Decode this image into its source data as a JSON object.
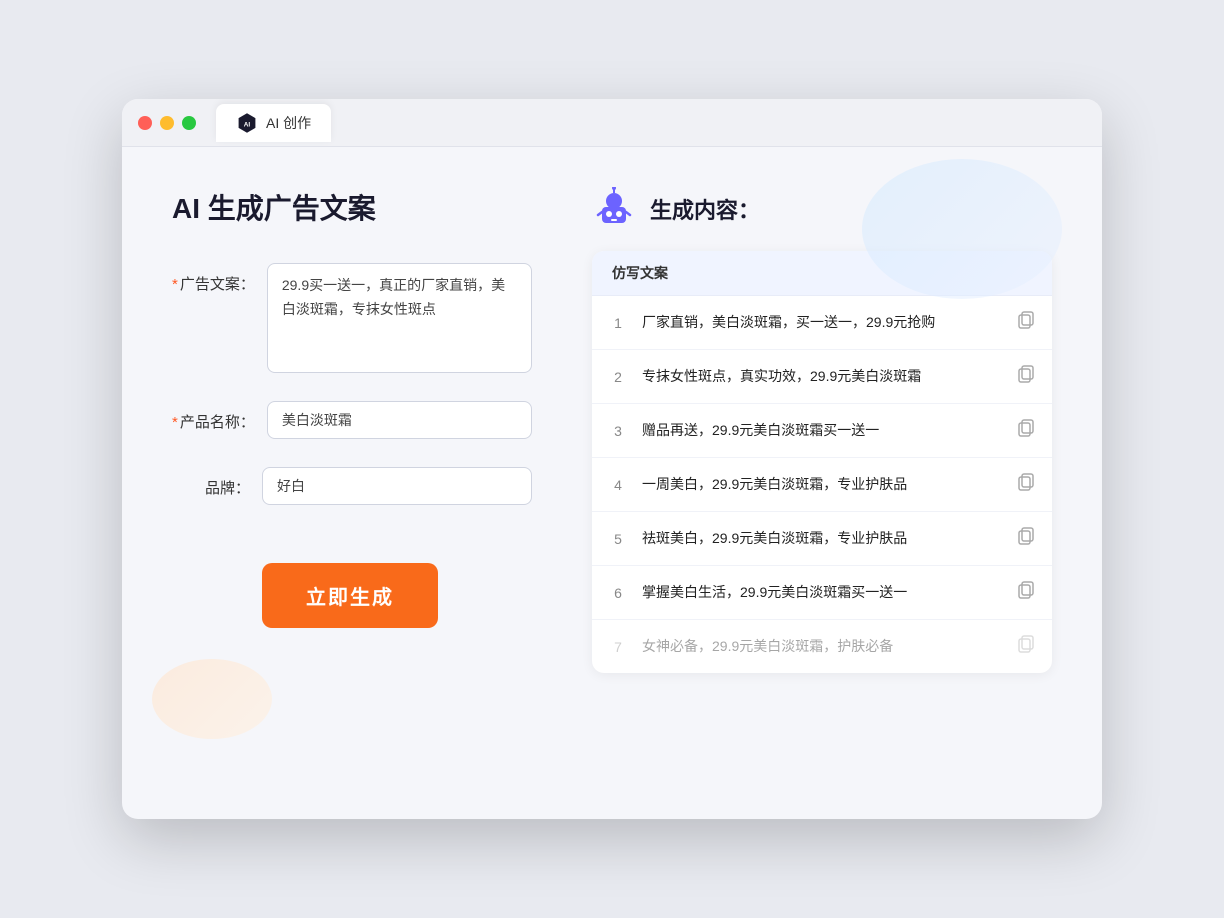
{
  "window": {
    "tab_label": "AI 创作"
  },
  "left": {
    "title": "AI 生成广告文案",
    "fields": [
      {
        "id": "ad_copy",
        "label": "广告文案：",
        "required": true,
        "type": "textarea",
        "value": "29.9买一送一，真正的厂家直销，美白淡斑霜，专抹女性斑点"
      },
      {
        "id": "product_name",
        "label": "产品名称：",
        "required": true,
        "type": "input",
        "value": "美白淡斑霜"
      },
      {
        "id": "brand",
        "label": "品牌：",
        "required": false,
        "type": "input",
        "value": "好白"
      }
    ],
    "generate_button": "立即生成"
  },
  "right": {
    "title": "生成内容：",
    "table_header": "仿写文案",
    "rows": [
      {
        "num": "1",
        "text": "厂家直销，美白淡斑霜，买一送一，29.9元抢购",
        "faded": false
      },
      {
        "num": "2",
        "text": "专抹女性斑点，真实功效，29.9元美白淡斑霜",
        "faded": false
      },
      {
        "num": "3",
        "text": "赠品再送，29.9元美白淡斑霜买一送一",
        "faded": false
      },
      {
        "num": "4",
        "text": "一周美白，29.9元美白淡斑霜，专业护肤品",
        "faded": false
      },
      {
        "num": "5",
        "text": "祛斑美白，29.9元美白淡斑霜，专业护肤品",
        "faded": false
      },
      {
        "num": "6",
        "text": "掌握美白生活，29.9元美白淡斑霜买一送一",
        "faded": false
      },
      {
        "num": "7",
        "text": "女神必备，29.9元美白淡斑霜，护肤必备",
        "faded": true
      }
    ]
  }
}
